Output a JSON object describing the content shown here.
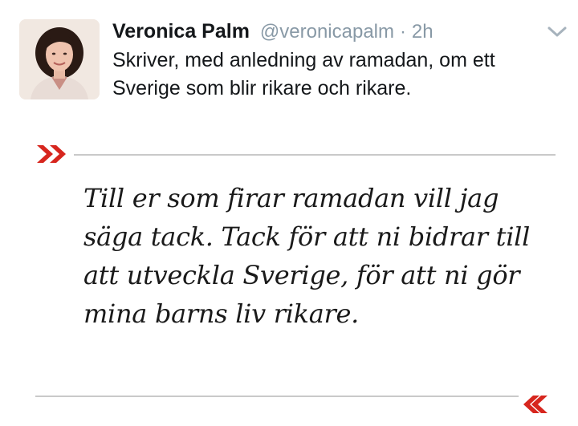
{
  "tweet": {
    "display_name": "Veronica Palm",
    "handle": "@veronicapalm",
    "separator": "·",
    "time": "2h",
    "text": "Skriver, med anledning av ramadan, om ett Sverige som blir rikare och rikare."
  },
  "quote": {
    "open_mark": "»",
    "close_mark": "«",
    "text": "Till er som firar ramadan vill jag säga tack. Tack för att ni bidrar till att utveckla Sverige, för att ni gör mina barns liv rikare.",
    "accent_color": "#d7261e"
  },
  "icons": {
    "menu": "chevron-down-icon",
    "avatar": "profile-photo"
  }
}
